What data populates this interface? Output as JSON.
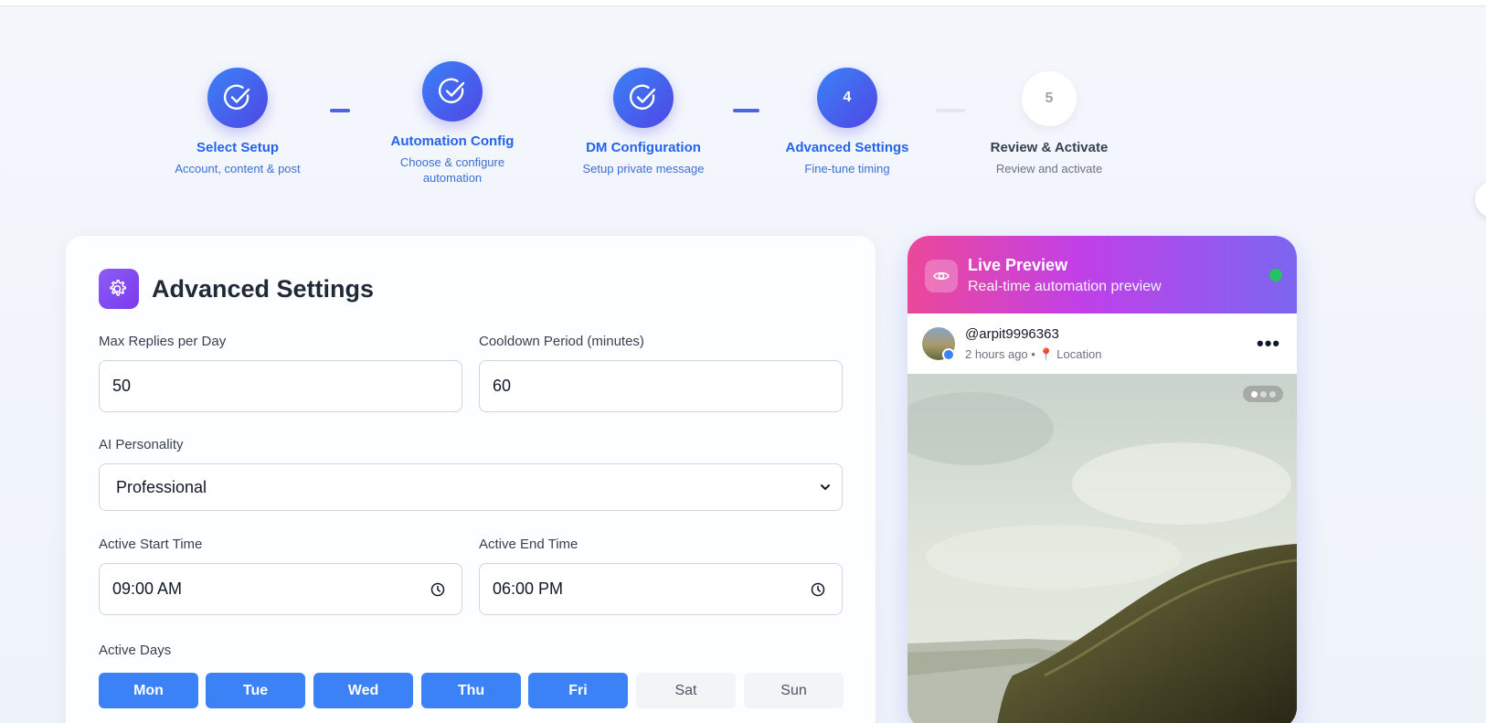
{
  "stepper": {
    "steps": [
      {
        "number": "1",
        "title": "Select Setup",
        "subtitle": "Account, content & post",
        "state": "done"
      },
      {
        "number": "2",
        "title": "Automation Config",
        "subtitle": "Choose & configure automation",
        "state": "done"
      },
      {
        "number": "3",
        "title": "DM Configuration",
        "subtitle": "Setup private message",
        "state": "done"
      },
      {
        "number": "4",
        "title": "Advanced Settings",
        "subtitle": "Fine-tune timing",
        "state": "active"
      },
      {
        "number": "5",
        "title": "Review & Activate",
        "subtitle": "Review and activate",
        "state": "pending"
      }
    ]
  },
  "settings": {
    "title": "Advanced Settings",
    "icon": "gear-icon",
    "max_replies": {
      "label": "Max Replies per Day",
      "value": "50"
    },
    "cooldown": {
      "label": "Cooldown Period (minutes)",
      "value": "60"
    },
    "personality": {
      "label": "AI Personality",
      "value": "Professional"
    },
    "start_time": {
      "label": "Active Start Time",
      "value": "09:00 AM"
    },
    "end_time": {
      "label": "Active End Time",
      "value": "06:00 PM"
    },
    "active_days": {
      "label": "Active Days",
      "days": [
        {
          "label": "Mon",
          "active": true
        },
        {
          "label": "Tue",
          "active": true
        },
        {
          "label": "Wed",
          "active": true
        },
        {
          "label": "Thu",
          "active": true
        },
        {
          "label": "Fri",
          "active": true
        },
        {
          "label": "Sat",
          "active": false
        },
        {
          "label": "Sun",
          "active": false
        }
      ]
    }
  },
  "preview": {
    "title": "Live Preview",
    "subtitle": "Real-time automation preview",
    "status_color": "#22c55e",
    "post": {
      "username": "@arpit9996363",
      "time": "2 hours ago",
      "separator": "•",
      "location": "Location",
      "carousel_count": 3,
      "carousel_current": 1
    }
  },
  "colors": {
    "accent": "#3b82f6",
    "step_gradient_end": "#4f46e5",
    "preview_gradient_start": "#ec4899",
    "preview_gradient_end": "#7c66f0"
  }
}
